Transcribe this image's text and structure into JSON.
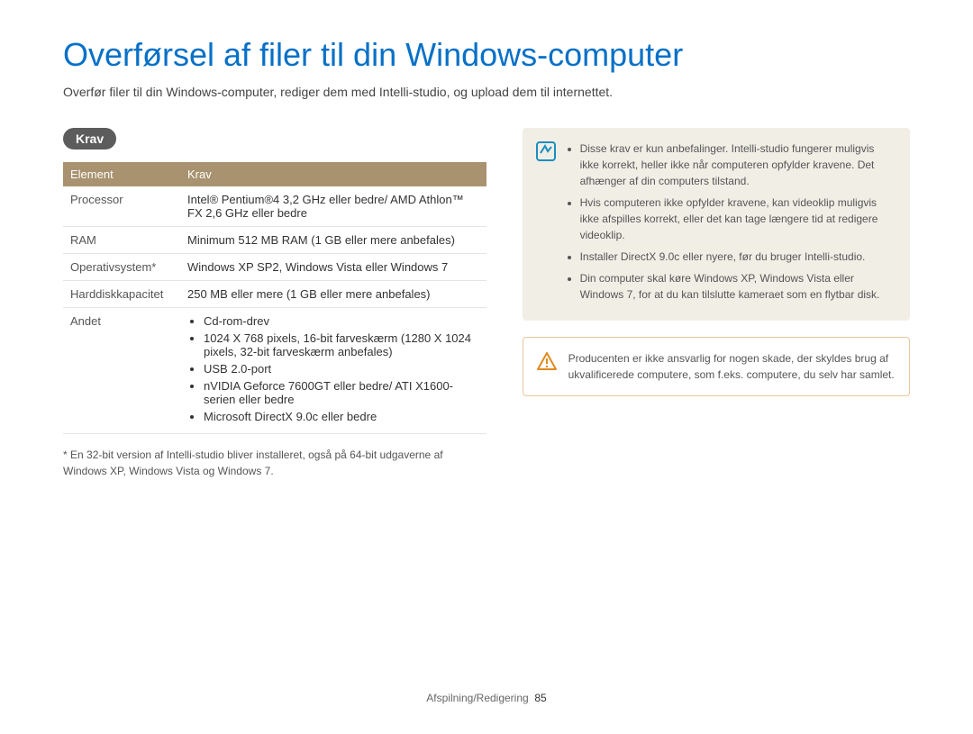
{
  "title": "Overførsel af filer til din Windows-computer",
  "intro": "Overfør filer til din Windows-computer, rediger dem med Intelli-studio, og upload dem til internettet.",
  "section_badge": "Krav",
  "table": {
    "header_element": "Element",
    "header_req": "Krav",
    "rows": {
      "processor": {
        "label": "Processor",
        "value": "Intel® Pentium®4 3,2 GHz eller bedre/ AMD Athlon™ FX 2,6 GHz eller bedre"
      },
      "ram": {
        "label": "RAM",
        "value": "Minimum 512 MB RAM (1 GB eller mere anbefales)"
      },
      "os": {
        "label": "Operativsystem*",
        "value": "Windows XP SP2, Windows Vista eller Windows 7"
      },
      "hdd": {
        "label": "Harddiskkapacitet",
        "value": "250 MB eller mere (1 GB eller mere anbefales)"
      },
      "other": {
        "label": "Andet",
        "items": [
          "Cd-rom-drev",
          "1024 X 768 pixels, 16-bit farveskærm (1280 X 1024 pixels, 32-bit farveskærm anbefales)",
          "USB 2.0-port",
          "nVIDIA Geforce 7600GT eller bedre/ ATI X1600-serien eller bedre",
          "Microsoft DirectX 9.0c eller bedre"
        ]
      }
    }
  },
  "footnote": "* En 32-bit version af Intelli-studio bliver installeret, også på 64-bit udgaverne af Windows XP, Windows Vista og Windows 7.",
  "info_box": {
    "items": [
      "Disse krav er kun anbefalinger. Intelli-studio fungerer muligvis ikke korrekt, heller ikke når computeren opfylder kravene. Det afhænger af din computers tilstand.",
      "Hvis computeren ikke opfylder kravene, kan videoklip muligvis ikke afspilles korrekt, eller det kan tage længere tid at redigere videoklip.",
      "Installer DirectX 9.0c eller nyere, før du bruger Intelli-studio.",
      "Din computer skal køre Windows XP, Windows Vista eller Windows 7, for at du kan tilslutte kameraet som en flytbar disk."
    ]
  },
  "warn_box": {
    "text": "Producenten er ikke ansvarlig for nogen skade, der skyldes brug af ukvalificerede computere, som f.eks. computere, du selv har samlet."
  },
  "footer": {
    "section": "Afspilning/Redigering",
    "page": "85"
  }
}
